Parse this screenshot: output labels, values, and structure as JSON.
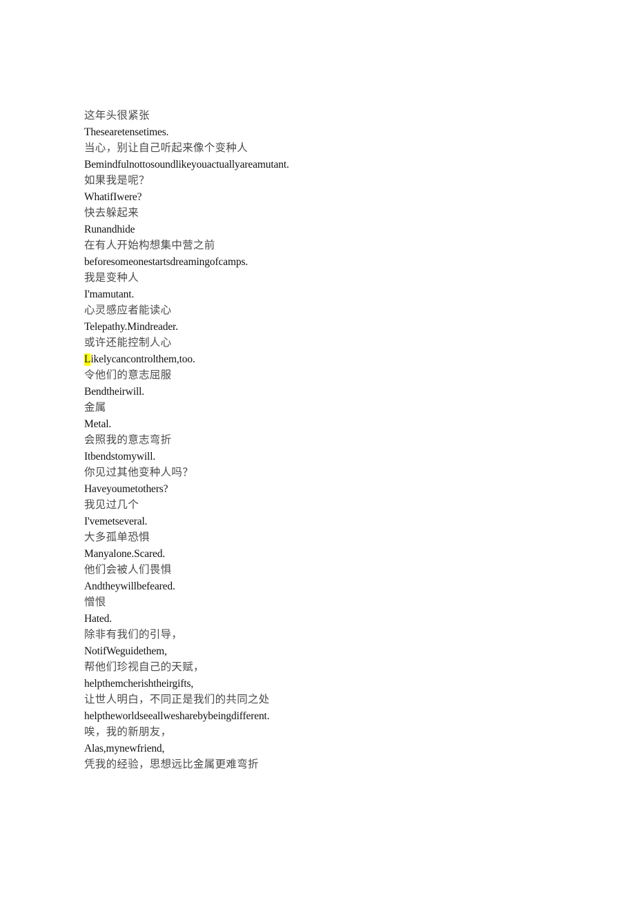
{
  "document": {
    "page_background": "#ffffff",
    "text_color_chinese": "#4a4a4a",
    "text_color_english": "#111111",
    "highlight_color": "#ffff00",
    "lines": [
      {
        "index": 0,
        "lang": "zh",
        "text": "这年头很紧张"
      },
      {
        "index": 1,
        "lang": "en",
        "text": "Thesearetensetimes."
      },
      {
        "index": 2,
        "lang": "zh",
        "text": "当心，别让自己听起来像个变种人"
      },
      {
        "index": 3,
        "lang": "en",
        "text": "Bemindfulnottosoundlikeyouactuallyareamutant."
      },
      {
        "index": 4,
        "lang": "zh",
        "text": "如果我是呢？"
      },
      {
        "index": 5,
        "lang": "en",
        "text": "WhatifIwere?"
      },
      {
        "index": 6,
        "lang": "zh",
        "text": "快去躲起来"
      },
      {
        "index": 7,
        "lang": "en",
        "text": "Runandhide"
      },
      {
        "index": 8,
        "lang": "zh",
        "text": "在有人开始构想集中营之前"
      },
      {
        "index": 9,
        "lang": "en",
        "text": "beforesomeonestartsdreamingofcamps."
      },
      {
        "index": 10,
        "lang": "zh",
        "text": "我是变种人"
      },
      {
        "index": 11,
        "lang": "en",
        "text": "I'mamutant."
      },
      {
        "index": 12,
        "lang": "zh",
        "text": "心灵感应者能读心"
      },
      {
        "index": 13,
        "lang": "en",
        "text": "Telepathy.Mindreader."
      },
      {
        "index": 14,
        "lang": "zh",
        "text": "或许还能控制人心"
      },
      {
        "index": 15,
        "lang": "en",
        "text": "Likelycancontrolthem,too.",
        "highlight_prefix": "L",
        "rest": "ikelycancontrolthem,too."
      },
      {
        "index": 16,
        "lang": "zh",
        "text": "令他们的意志屈服"
      },
      {
        "index": 17,
        "lang": "en",
        "text": "Bendtheirwill."
      },
      {
        "index": 18,
        "lang": "zh",
        "text": "金属"
      },
      {
        "index": 19,
        "lang": "en",
        "text": "Metal."
      },
      {
        "index": 20,
        "lang": "zh",
        "text": "会照我的意志弯折"
      },
      {
        "index": 21,
        "lang": "en",
        "text": "Itbendstomywill."
      },
      {
        "index": 22,
        "lang": "zh",
        "text": "你见过其他变种人吗？"
      },
      {
        "index": 23,
        "lang": "en",
        "text": "Haveyoumetothers?"
      },
      {
        "index": 24,
        "lang": "zh",
        "text": "我见过几个"
      },
      {
        "index": 25,
        "lang": "en",
        "text": "I'vemetseveral."
      },
      {
        "index": 26,
        "lang": "zh",
        "text": "大多孤单恐惧"
      },
      {
        "index": 27,
        "lang": "en",
        "text": "Manyalone.Scared."
      },
      {
        "index": 28,
        "lang": "zh",
        "text": "他们会被人们畏惧"
      },
      {
        "index": 29,
        "lang": "en",
        "text": "Andtheywillbefeared."
      },
      {
        "index": 30,
        "lang": "zh",
        "text": "憎恨"
      },
      {
        "index": 31,
        "lang": "en",
        "text": "Hated."
      },
      {
        "index": 32,
        "lang": "zh",
        "text": "除非有我们的引导，"
      },
      {
        "index": 33,
        "lang": "en",
        "text": "NotifWeguidethem,"
      },
      {
        "index": 34,
        "lang": "zh",
        "text": "帮他们珍视自己的天赋，"
      },
      {
        "index": 35,
        "lang": "en",
        "text": "helpthemcherishtheirgifts,"
      },
      {
        "index": 36,
        "lang": "zh",
        "text": "让世人明白，不同正是我们的共同之处"
      },
      {
        "index": 37,
        "lang": "en",
        "text": "helptheworldseeallwesharebybeingdifferent."
      },
      {
        "index": 38,
        "lang": "zh",
        "text": "唉，我的新朋友，"
      },
      {
        "index": 39,
        "lang": "en",
        "text": "Alas,mynewfriend,"
      },
      {
        "index": 40,
        "lang": "zh",
        "text": "凭我的经验，思想远比金属更难弯折"
      }
    ]
  }
}
